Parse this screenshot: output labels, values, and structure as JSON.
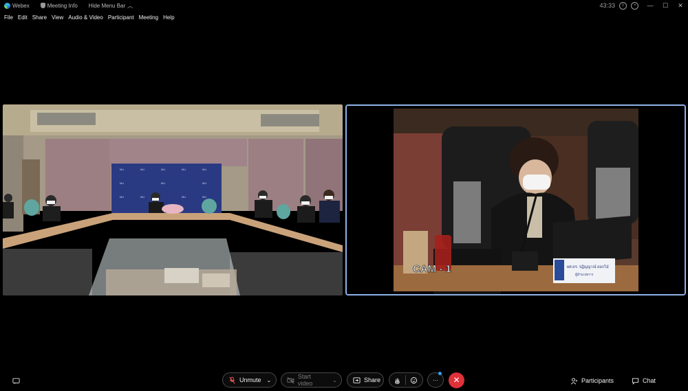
{
  "titlebar": {
    "app_name": "Webex",
    "meeting_info": "Meeting Info",
    "hide_menu_bar": "Hide Menu Bar",
    "clock": "43:33",
    "icons": [
      "webex-logo-icon",
      "shield-icon",
      "chevron-up-icon",
      "info-icon",
      "timer-icon",
      "minimize-icon",
      "maximize-icon",
      "close-icon"
    ]
  },
  "menubar": {
    "items": [
      "File",
      "Edit",
      "Share",
      "View",
      "Audio & Video",
      "Participant",
      "Meeting",
      "Help"
    ]
  },
  "video": {
    "right_overlay_text": "CAM - 1",
    "nameplate_line1": "ผศ.ดร. ปฏิญญาณ์ ดอกไม้",
    "nameplate_line2": "ผู้อำนวยการ"
  },
  "controls": {
    "unmute": "Unmute",
    "start_video": "Start video",
    "share": "Share",
    "participants": "Participants",
    "chat": "Chat",
    "more": "···",
    "end": "✕"
  },
  "colors": {
    "end_button": "#e0303a",
    "active_speaker_border": "#8fb4e8",
    "badge": "#3aa0ff"
  }
}
